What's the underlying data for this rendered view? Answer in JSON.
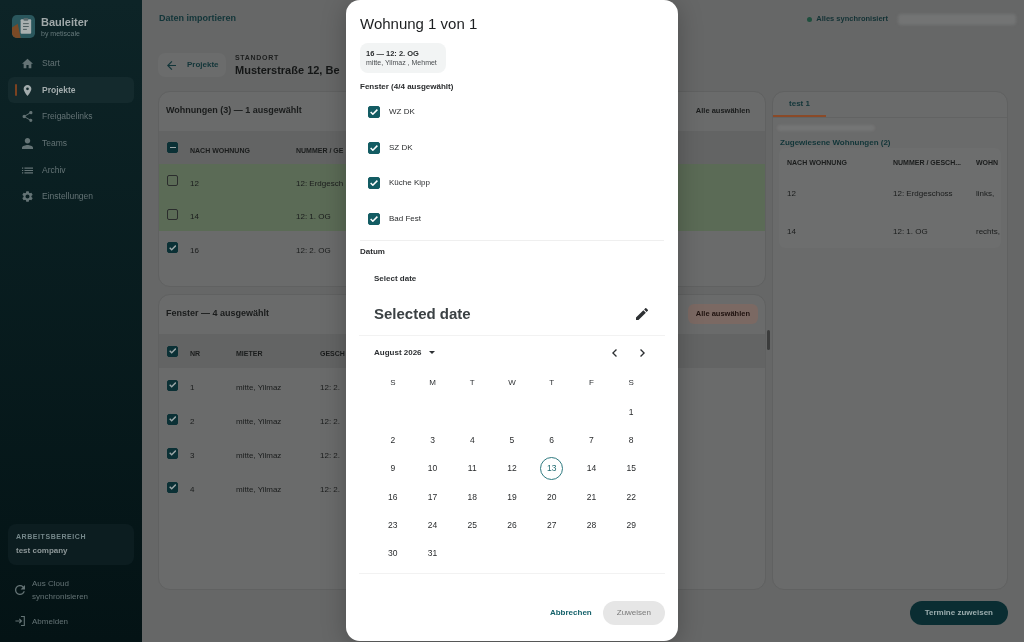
{
  "sidebar": {
    "app_name": "Bauleiter",
    "app_subtitle": "by metiscale",
    "nav": [
      {
        "label": "Start",
        "selected": false
      },
      {
        "label": "Projekte",
        "selected": true
      },
      {
        "label": "Freigabelinks",
        "selected": false
      },
      {
        "label": "Teams",
        "selected": false
      },
      {
        "label": "Archiv",
        "selected": false
      },
      {
        "label": "Einstellungen",
        "selected": false
      }
    ],
    "workspace": {
      "caption": "ARBEITSBEREICH",
      "name": "test company"
    },
    "actions": [
      {
        "label": "Aus Cloud synchronisieren"
      },
      {
        "label": "Abmelden"
      }
    ]
  },
  "header": {
    "title": "Daten importieren",
    "sync_status": "Alles synchronisiert"
  },
  "project": {
    "back_label": "Projekte",
    "caption": "STANDORT",
    "address": "Musterstraße 12, Be"
  },
  "apartments_card": {
    "title": "Wohnungen (3) — 1 ausgewählt",
    "select_all_button": {
      "label": "Alle auswählen",
      "highlighted": false
    },
    "select_all_checked": true,
    "select_all_indeterminate": true,
    "columns": [
      "NACH WOHNUNG",
      "NUMMER / GE"
    ],
    "rows": [
      {
        "cells": [
          "12",
          "12: Erdgesch"
        ],
        "checked": false,
        "assigned": true
      },
      {
        "cells": [
          "14",
          "12: 1. OG"
        ],
        "checked": false,
        "assigned": true
      },
      {
        "cells": [
          "16",
          "12: 2. OG"
        ],
        "checked": true,
        "assigned": false
      }
    ]
  },
  "windows_card": {
    "title": "Fenster — 4 ausgewählt",
    "select_all_button": {
      "label": "Alle auswählen",
      "highlighted": true
    },
    "select_all_checked": true,
    "select_all_indeterminate": false,
    "columns": [
      "NR",
      "MIETER",
      "GESCH"
    ],
    "rows": [
      {
        "cells": [
          "1",
          "mitte, Yilmaz",
          "12: 2."
        ],
        "checked": true
      },
      {
        "cells": [
          "2",
          "mitte, Yilmaz",
          "12: 2."
        ],
        "checked": true
      },
      {
        "cells": [
          "3",
          "mitte, Yilmaz",
          "12: 2."
        ],
        "checked": true
      },
      {
        "cells": [
          "4",
          "mitte, Yilmaz",
          "12: 2."
        ],
        "checked": true
      }
    ]
  },
  "assignment_panel": {
    "tabs": [
      {
        "label": "test 1",
        "selected": true
      }
    ],
    "subtitle": "Zugewiesene Wohnungen (2)",
    "columns": [
      "NACH WOHNUNG",
      "NUMMER / GESCH...",
      "WOHN"
    ],
    "rows": [
      [
        "12",
        "12: Erdgeschoss",
        "links,"
      ],
      [
        "14",
        "12: 1. OG",
        "rechts,"
      ]
    ]
  },
  "footer": {
    "primary_button": "Termine zuweisen"
  },
  "dialog": {
    "title": "Wohnung 1 von 1",
    "apartment": {
      "heading": "16 — 12: 2. OG",
      "tenants": "mitte, Yilmaz , Mehmet"
    },
    "windows_label": "Fenster (4/4 ausgewählt)",
    "windows": [
      {
        "label": "WZ DK",
        "checked": true
      },
      {
        "label": "SZ DK",
        "checked": true
      },
      {
        "label": "Küche Kipp",
        "checked": true
      },
      {
        "label": "Bad Fest",
        "checked": true
      }
    ],
    "date_label": "Datum",
    "date_picker": {
      "header_label": "Select date",
      "headline": "Selected date",
      "month_label": "August 2026",
      "weekdays": [
        "S",
        "M",
        "T",
        "W",
        "T",
        "F",
        "S"
      ],
      "weeks": [
        [
          {
            "label": "1",
            "today": false,
            "selected": false
          }
        ],
        [
          {
            "label": "2",
            "today": false,
            "selected": false
          },
          {
            "label": "3",
            "today": false,
            "selected": false
          },
          {
            "label": "4",
            "today": false,
            "selected": false
          },
          {
            "label": "5",
            "today": false,
            "selected": false
          },
          {
            "label": "6",
            "today": false,
            "selected": false
          },
          {
            "label": "7",
            "today": false,
            "selected": false
          },
          {
            "label": "8",
            "today": false,
            "selected": false
          }
        ],
        [
          {
            "label": "9",
            "today": false,
            "selected": false
          },
          {
            "label": "10",
            "today": false,
            "selected": false
          },
          {
            "label": "11",
            "today": false,
            "selected": false
          },
          {
            "label": "12",
            "today": false,
            "selected": false
          },
          {
            "label": "13",
            "today": true,
            "selected": false
          },
          {
            "label": "14",
            "today": false,
            "selected": false
          },
          {
            "label": "15",
            "today": false,
            "selected": false
          }
        ],
        [
          {
            "label": "16",
            "today": false,
            "selected": false
          },
          {
            "label": "17",
            "today": false,
            "selected": false
          },
          {
            "label": "18",
            "today": false,
            "selected": false
          },
          {
            "label": "19",
            "today": false,
            "selected": false
          },
          {
            "label": "20",
            "today": false,
            "selected": false
          },
          {
            "label": "21",
            "today": false,
            "selected": false
          },
          {
            "label": "22",
            "today": false,
            "selected": false
          }
        ],
        [
          {
            "label": "23",
            "today": false,
            "selected": false
          },
          {
            "label": "24",
            "today": false,
            "selected": false
          },
          {
            "label": "25",
            "today": false,
            "selected": false
          },
          {
            "label": "26",
            "today": false,
            "selected": false
          },
          {
            "label": "27",
            "today": false,
            "selected": false
          },
          {
            "label": "28",
            "today": false,
            "selected": false
          },
          {
            "label": "29",
            "today": false,
            "selected": false
          }
        ],
        [
          {
            "label": "30",
            "today": false,
            "selected": false
          },
          {
            "label": "31",
            "today": false,
            "selected": false
          }
        ]
      ]
    },
    "buttons": [
      {
        "label": "Abbrechen",
        "kind": "text",
        "disabled": false
      },
      {
        "label": "Zuweisen",
        "kind": "filled",
        "disabled": true
      }
    ]
  }
}
